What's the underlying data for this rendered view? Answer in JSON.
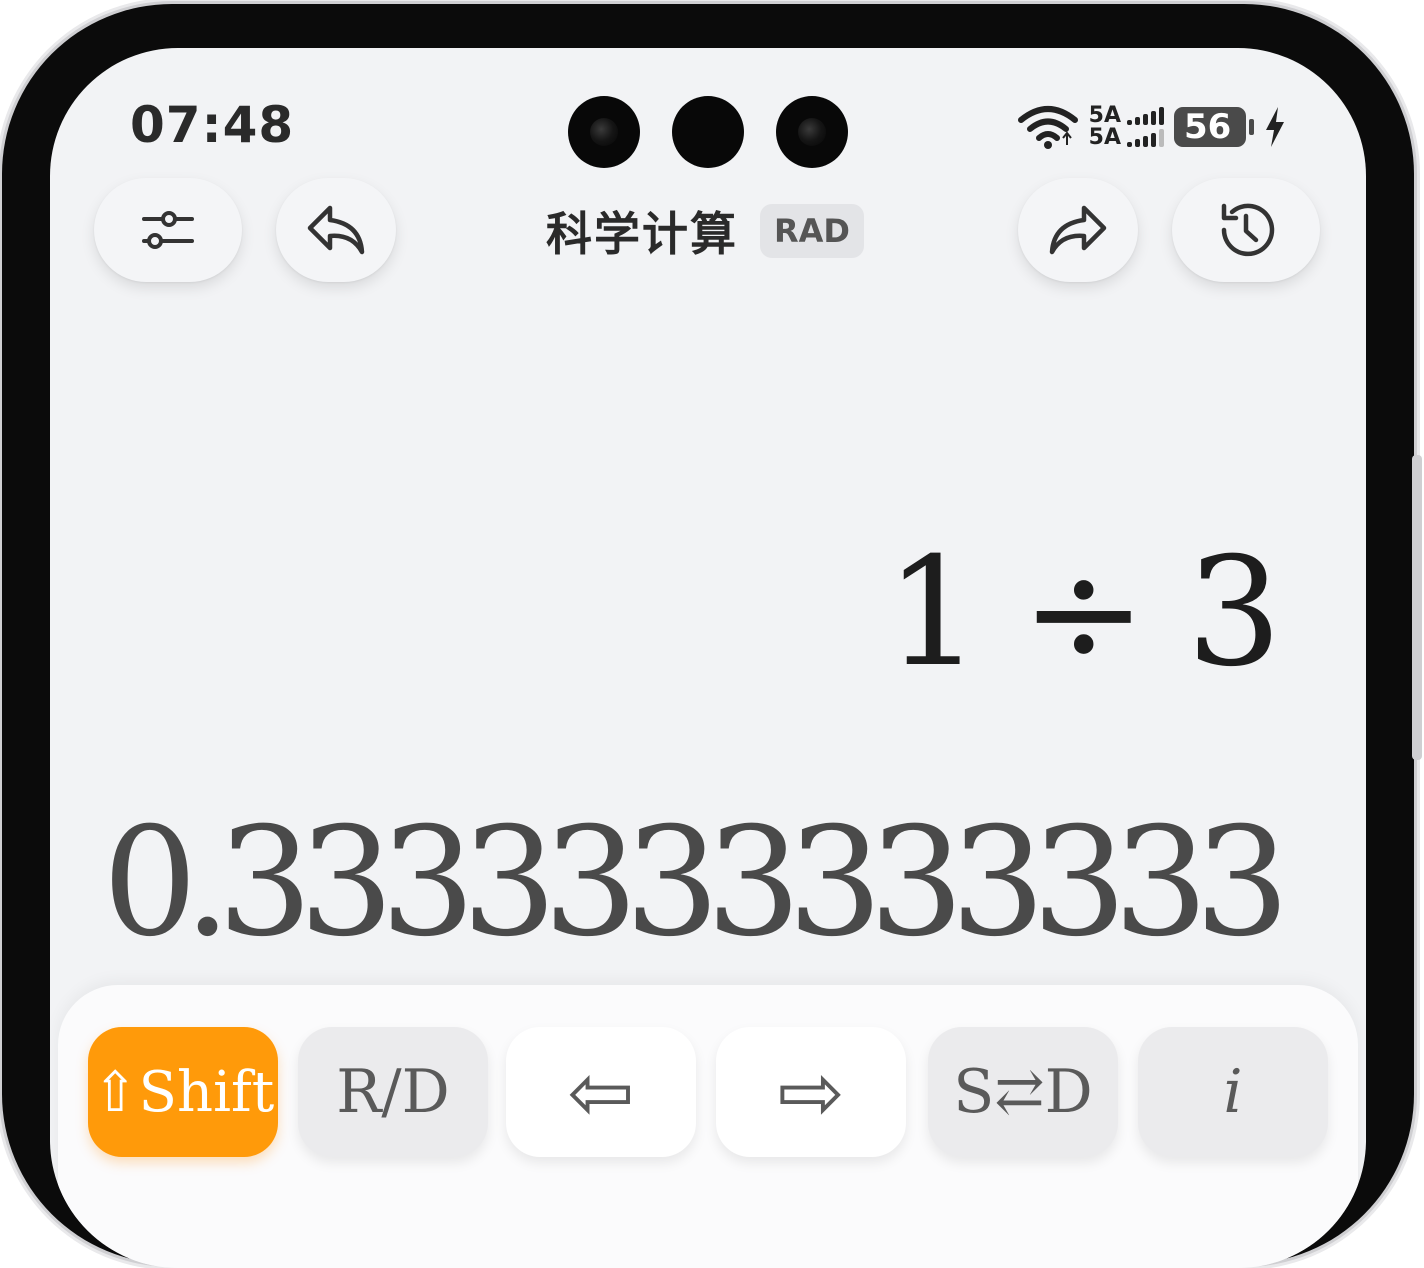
{
  "status_bar": {
    "time": "07:48",
    "network_1": "5A",
    "network_2": "5A",
    "battery_level": "56"
  },
  "header": {
    "title": "科学计算",
    "mode_badge": "RAD"
  },
  "display": {
    "expression": {
      "left": "1",
      "operator": "÷",
      "right": "3"
    },
    "result": "0.3333333333333"
  },
  "keypad": {
    "keys": [
      {
        "label": "⇧Shift"
      },
      {
        "label": "R/D"
      },
      {
        "label": "⇦"
      },
      {
        "label": "⇨"
      },
      {
        "label": "S⇄D"
      },
      {
        "label": "i"
      }
    ]
  },
  "colors": {
    "accent_orange": "#ff9a0a",
    "screen_bg": "#f2f3f5",
    "key_grey": "#ebebed",
    "key_white": "#ffffff"
  }
}
